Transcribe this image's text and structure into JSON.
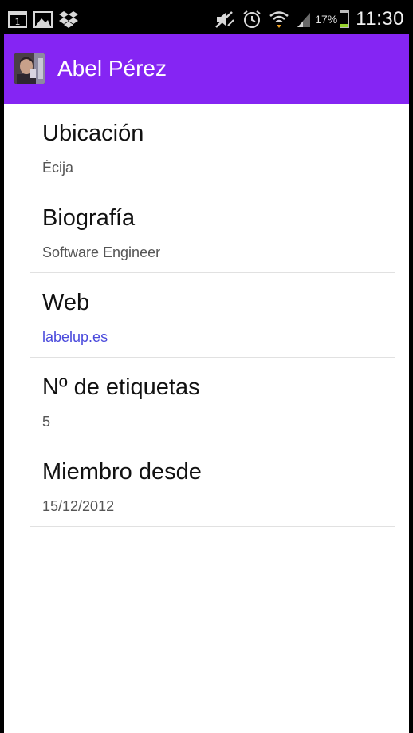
{
  "status_bar": {
    "left_icons": [
      "calendar-notification-icon",
      "gallery-notification-icon",
      "dropbox-icon"
    ],
    "right_icons": [
      "mute-icon",
      "alarm-icon",
      "wifi-icon",
      "signal-icon"
    ],
    "battery_percent_label": "17%",
    "battery_level": 0.17,
    "calendar_day": "1",
    "time": "11:30"
  },
  "action_bar": {
    "title": "Abel Pérez",
    "avatar_icon": "user-avatar",
    "color": "#8525f3"
  },
  "profile": {
    "items": [
      {
        "label": "Ubicación",
        "value": "Écija",
        "is_link": false
      },
      {
        "label": "Biografía",
        "value": "Software Engineer",
        "is_link": false
      },
      {
        "label": "Web",
        "value": "labelup.es",
        "is_link": true
      },
      {
        "label": "Nº de etiquetas",
        "value": "5",
        "is_link": false
      },
      {
        "label": "Miembro desde",
        "value": "15/12/2012",
        "is_link": false
      }
    ]
  },
  "colors": {
    "link": "#4a4adc",
    "divider": "#e1e1e1",
    "battery": "#96d22b"
  }
}
